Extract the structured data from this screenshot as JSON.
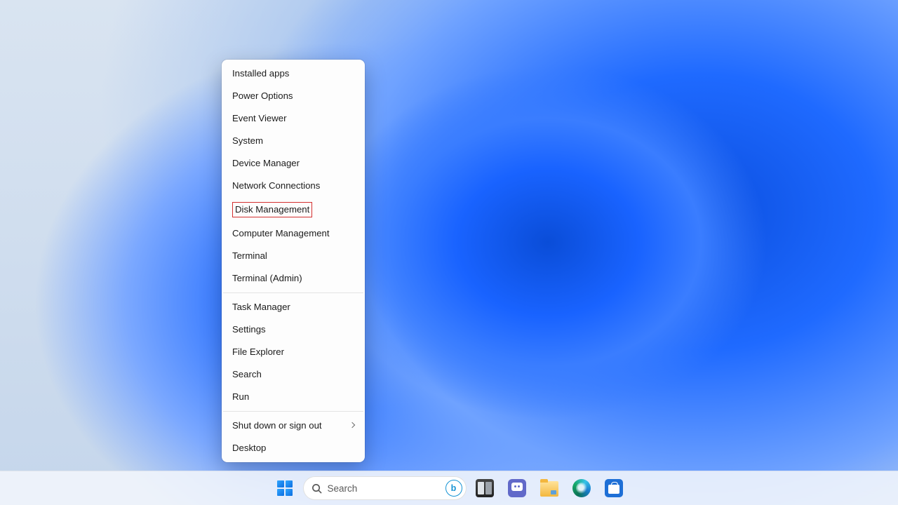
{
  "menu": {
    "groups": [
      [
        {
          "label": "Installed apps",
          "name": "menu-installed-apps"
        },
        {
          "label": "Power Options",
          "name": "menu-power-options"
        },
        {
          "label": "Event Viewer",
          "name": "menu-event-viewer"
        },
        {
          "label": "System",
          "name": "menu-system"
        },
        {
          "label": "Device Manager",
          "name": "menu-device-manager"
        },
        {
          "label": "Network Connections",
          "name": "menu-network-connections"
        },
        {
          "label": "Disk Management",
          "name": "menu-disk-management",
          "highlighted": true
        },
        {
          "label": "Computer Management",
          "name": "menu-computer-management"
        },
        {
          "label": "Terminal",
          "name": "menu-terminal"
        },
        {
          "label": "Terminal (Admin)",
          "name": "menu-terminal-admin"
        }
      ],
      [
        {
          "label": "Task Manager",
          "name": "menu-task-manager"
        },
        {
          "label": "Settings",
          "name": "menu-settings"
        },
        {
          "label": "File Explorer",
          "name": "menu-file-explorer"
        },
        {
          "label": "Search",
          "name": "menu-search"
        },
        {
          "label": "Run",
          "name": "menu-run"
        }
      ],
      [
        {
          "label": "Shut down or sign out",
          "name": "menu-shutdown-signout",
          "submenu": true
        },
        {
          "label": "Desktop",
          "name": "menu-desktop"
        }
      ]
    ]
  },
  "taskbar": {
    "search_placeholder": "Search",
    "bing_letter": "b",
    "apps": [
      {
        "name": "taskbar-task-view",
        "title": "Task view"
      },
      {
        "name": "taskbar-chat",
        "title": "Chat"
      },
      {
        "name": "taskbar-file-explorer",
        "title": "File Explorer"
      },
      {
        "name": "taskbar-edge",
        "title": "Microsoft Edge"
      },
      {
        "name": "taskbar-store",
        "title": "Microsoft Store"
      }
    ]
  }
}
